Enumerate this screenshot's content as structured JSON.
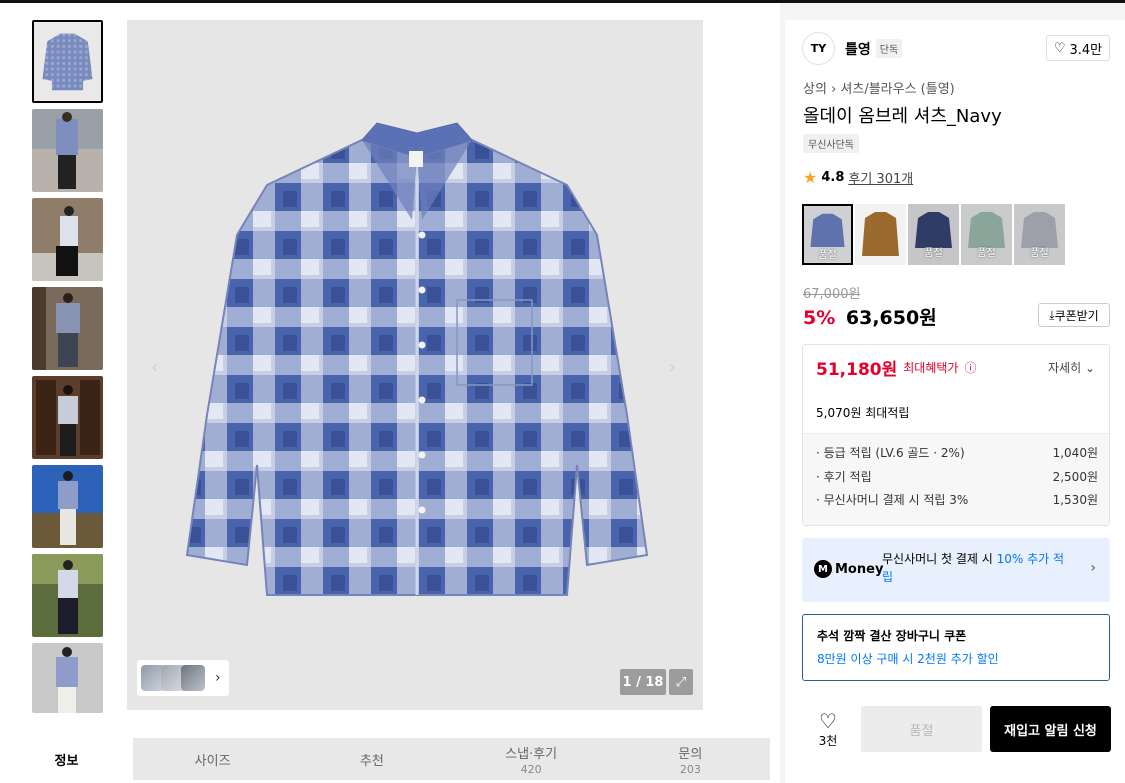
{
  "gallery": {
    "thumb_count": 8,
    "counter": "1 / 18"
  },
  "tabs": [
    {
      "label": "정보",
      "count": ""
    },
    {
      "label": "사이즈",
      "count": ""
    },
    {
      "label": "추천",
      "count": ""
    },
    {
      "label": "스냅·후기",
      "count": "420"
    },
    {
      "label": "문의",
      "count": "203"
    }
  ],
  "brand": {
    "logo_text": "TY",
    "name": "틀영",
    "tag": "단독",
    "likes": "3.4만"
  },
  "product": {
    "breadcrumb_1": "상의",
    "breadcrumb_2": "셔츠/블라우스 (틀영)",
    "title": "올데이 옴브레 셔츠_Navy",
    "badge": "무신사단독",
    "rating": "4.8",
    "reviews": "후기 301개",
    "colors": [
      {
        "name": "navy",
        "sold_out": "품절"
      },
      {
        "name": "brown",
        "sold_out": ""
      },
      {
        "name": "dark-navy",
        "sold_out": "품절"
      },
      {
        "name": "green",
        "sold_out": "품절"
      },
      {
        "name": "grey",
        "sold_out": "품절"
      }
    ],
    "original_price": "67,000원",
    "discount": "5%",
    "price": "63,650원",
    "coupon_label": "쿠폰받기"
  },
  "benefit": {
    "best_price": "51,180원",
    "best_label": "최대혜택가",
    "detail_label": "자세히",
    "point_total": "5,070원 최대적립",
    "points": [
      {
        "label": "· 등급 적립 (LV.6 골드 · 2%)",
        "value": "1,040원"
      },
      {
        "label": "· 후기 적립",
        "value": "2,500원"
      },
      {
        "label": "· 무신사머니 결제 시 적립 3%",
        "value": "1,530원"
      }
    ]
  },
  "money": {
    "brand": "Money",
    "text_1": "무신사머니 첫 결제 시 ",
    "text_blue": "10% 추가 적립"
  },
  "cart_coupon": {
    "title": "추석 깜짝 결산 장바구니 쿠폰",
    "desc": "8만원 이상 구매 시 2천원 추가 할인"
  },
  "actions": {
    "like_count": "3천",
    "sold_out": "품절",
    "restock": "재입고 알림 신청"
  },
  "colors": {
    "accent_red": "#e5002b",
    "accent_blue": "#0078ff",
    "plaid_navy": "#3d5aa8"
  }
}
